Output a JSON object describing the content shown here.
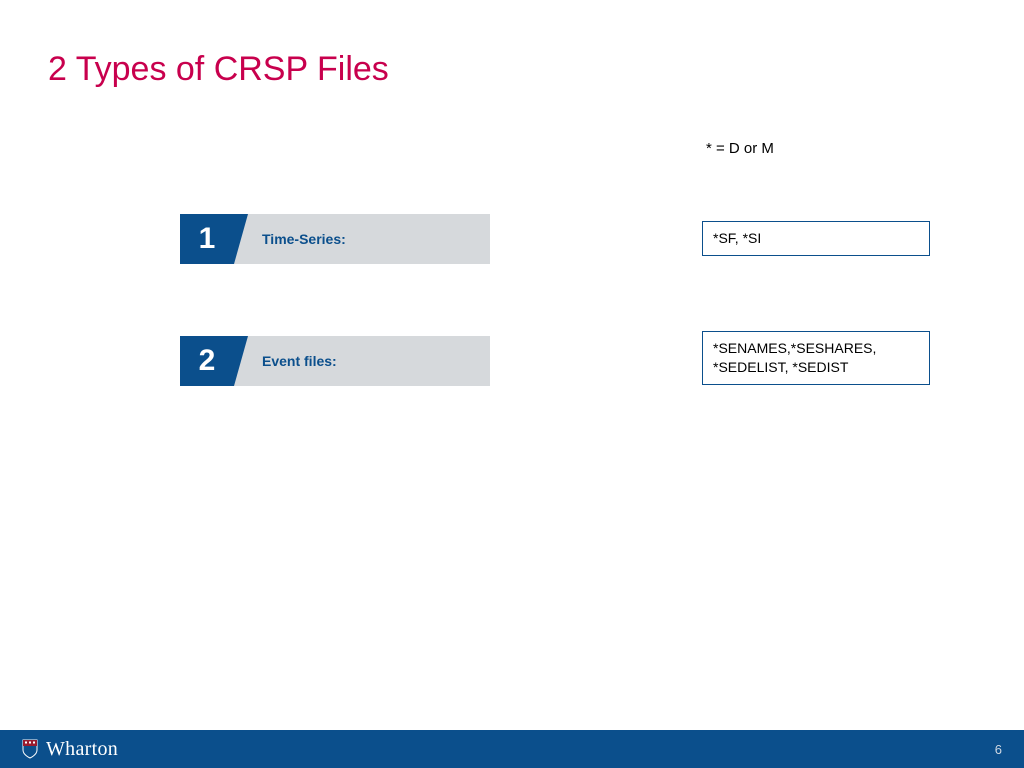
{
  "title": "2 Types of CRSP Files",
  "legend": "* = D or M",
  "categories": [
    {
      "num": "1",
      "label": "Time-Series:"
    },
    {
      "num": "2",
      "label": "Event files:"
    }
  ],
  "file_boxes": [
    "*SF, *SI",
    "*SENAMES,*SESHARES, *SEDELIST, *SEDIST"
  ],
  "footer": {
    "brand": "Wharton",
    "page": "6"
  }
}
